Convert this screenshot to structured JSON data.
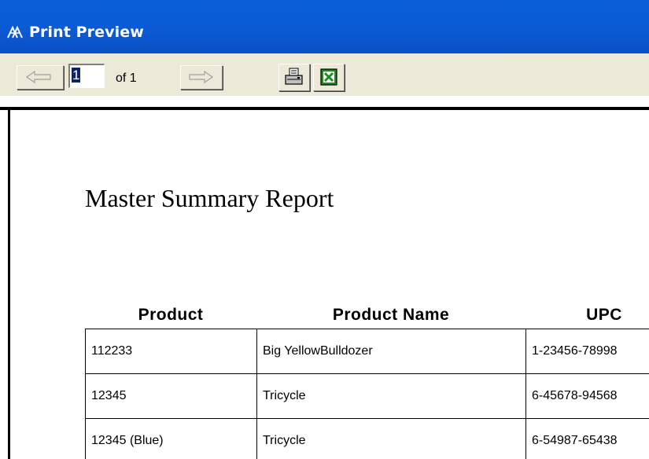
{
  "window": {
    "title": "Print Preview",
    "colors": {
      "titlebar": "#0a5fd8",
      "toolbar": "#ece9d8",
      "excel_green": "#1e8c1e"
    }
  },
  "toolbar": {
    "prev_icon": "arrow-left-icon",
    "next_icon": "arrow-right-icon",
    "page_value": "1",
    "of_label": "of 1",
    "print_icon": "printer-icon",
    "export_icon": "excel-export-icon"
  },
  "report": {
    "title": "Master Summary Report",
    "columns": [
      "Product",
      "Product Name",
      "UPC"
    ],
    "rows": [
      [
        "112233",
        "Big YellowBulldozer",
        "1-23456-78998"
      ],
      [
        "12345",
        "Tricycle",
        "6-45678-94568"
      ],
      [
        "12345 (Blue)",
        "Tricycle",
        "6-54987-65438"
      ]
    ]
  }
}
